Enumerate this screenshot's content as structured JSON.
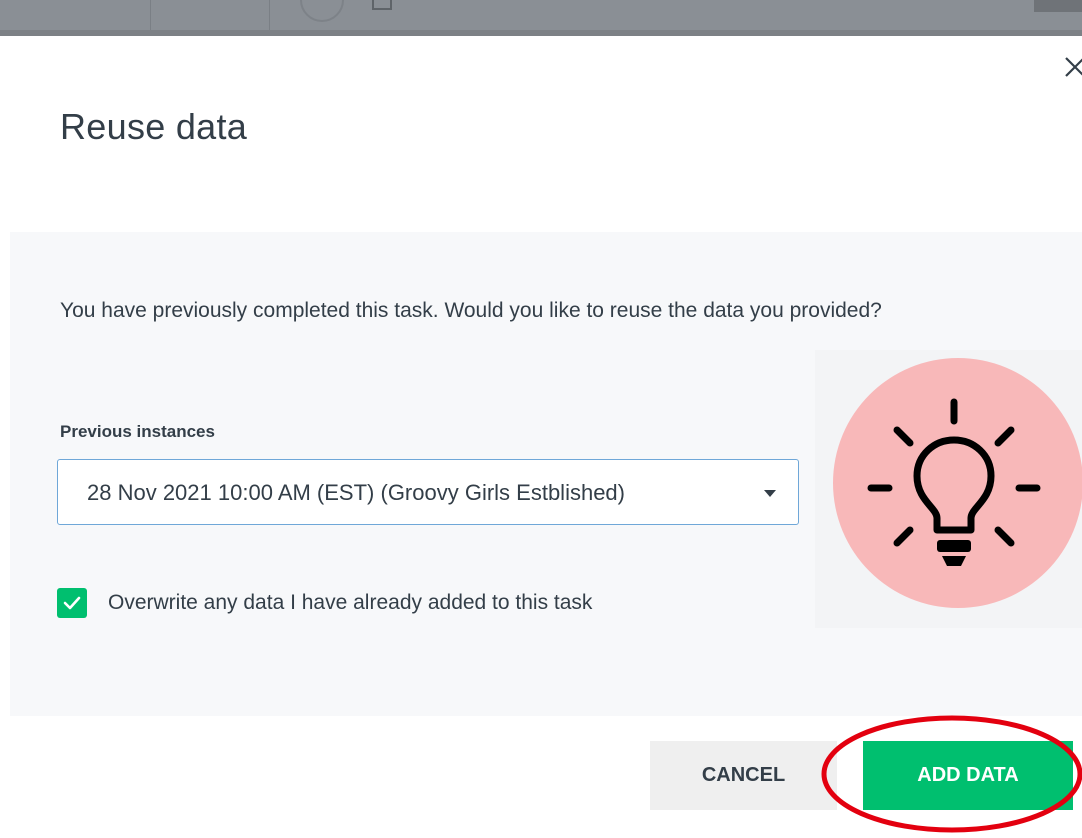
{
  "modal": {
    "title": "Reuse data",
    "prompt": "You have previously completed this task. Would you like to reuse the data you provided?",
    "previous_instances": {
      "label": "Previous instances",
      "selected": "28 Nov 2021 10:00 AM (EST) (Groovy Girls Estblished)"
    },
    "overwrite": {
      "label": "Overwrite any data I have already added to this task",
      "checked": true
    },
    "actions": {
      "cancel_label": "CANCEL",
      "add_label": "ADD DATA"
    }
  },
  "colors": {
    "accent_green": "#00bf6f",
    "text_dark": "#333e48",
    "panel_bg": "#f7f8fa",
    "highlight_red": "#e3000f",
    "tip_circle": "#f8b8b9",
    "select_border": "#6fa7d8"
  },
  "icons": {
    "close": "close-icon",
    "caret": "caret-down-icon",
    "check": "checkmark-icon",
    "tip": "lightbulb-icon"
  }
}
